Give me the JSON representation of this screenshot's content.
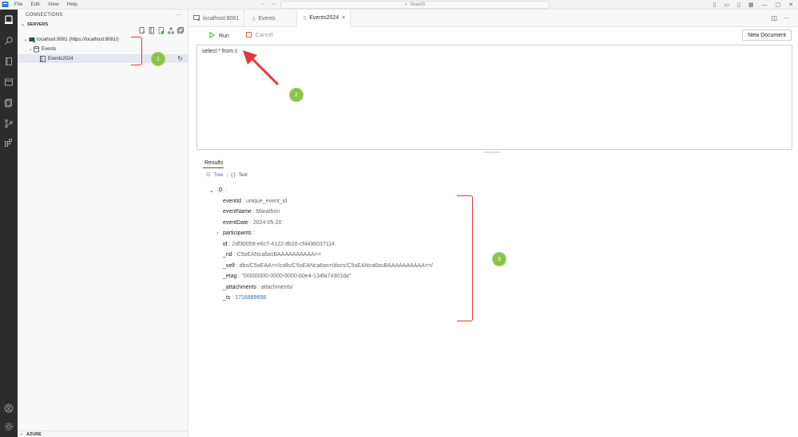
{
  "menu": {
    "items": [
      "File",
      "Edit",
      "View",
      "Help"
    ],
    "search_placeholder": "Search"
  },
  "sidebar": {
    "header": "CONNECTIONS",
    "more": "···",
    "section": "SERVERS",
    "tree": {
      "server": "localhost:8081 (https://localhost:8081/)",
      "database": "Events",
      "container": "Events2024"
    },
    "footer_section": "AZURE"
  },
  "tabs": [
    {
      "label": "localhost:8081",
      "icon": "server-icon"
    },
    {
      "label": "Events",
      "icon": "file-icon"
    },
    {
      "label": "Events2024",
      "icon": "file-icon",
      "close": "×"
    }
  ],
  "editor": {
    "run_label": "Run",
    "cancel_label": "Cancel",
    "new_document_label": "New Document",
    "query": "select * from c"
  },
  "results": {
    "title": "Results",
    "view_tree": "Tree",
    "view_text": "Text",
    "index": "0",
    "fields": [
      {
        "key": "eventId",
        "value": "unique_event_id"
      },
      {
        "key": "eventName",
        "value": "Marathon"
      },
      {
        "key": "eventDate",
        "value": "2024-05-20"
      },
      {
        "key": "participants",
        "value": "",
        "expandable": true
      },
      {
        "key": "id",
        "value": "2df30059-e6c7-4122-8b16-cf4496037114"
      },
      {
        "key": "_rid",
        "value": "C5oEANca6asBAAAAAAAAAA=="
      },
      {
        "key": "_self",
        "value": "dbs/C5oEAA==/colls/C5oEANca6as=/docs/C5oEANca6asBAAAAAAAAAA==/"
      },
      {
        "key": "_etag",
        "value": "\"00000000-0000-0000-b0e4-134fa74301da\""
      },
      {
        "key": "_attachments",
        "value": "attachments/"
      },
      {
        "key": "_ts",
        "value": "1716889658",
        "numeric": true
      }
    ]
  },
  "annotations": {
    "one": "1",
    "two": "2",
    "three": "3",
    "bracket_color": "#e53935",
    "badge_color": "#8bc34a"
  },
  "colors": {
    "activitybar": "#2c2c2c",
    "accent": "#4a5bc4",
    "run_green": "#3c9a3c",
    "cancel_red": "#d9534f"
  }
}
